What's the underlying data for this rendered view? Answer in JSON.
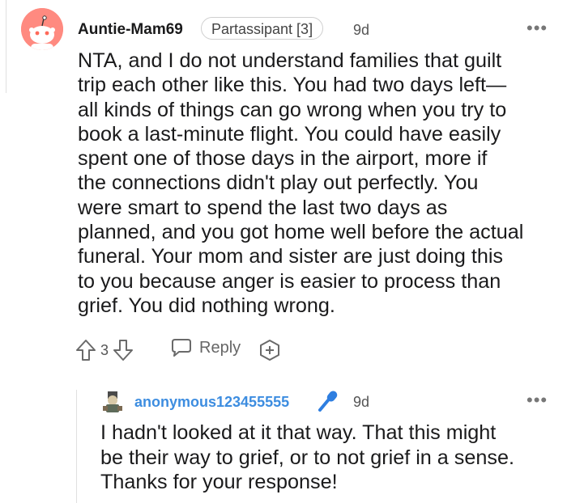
{
  "comment": {
    "author": "Auntie-Mam69",
    "flair": "Partassipant [3]",
    "age": "9d",
    "more": "•••",
    "body": "NTA, and I do not understand families that guilt\ntrip each other like this. You had two days left—\nall kinds of things can go wrong when you try to\nbook a last-minute flight. You could have easily\nspent one of those days in the airport, more if\nthe connections didn't play out perfectly. You\nwere smart to spend the last two days as\nplanned, and you got home well before the actual\nfuneral. Your mom and sister are just doing this\nto you because anger is easier to process than\ngrief. You did nothing wrong.",
    "score": "3",
    "reply_label": "Reply",
    "icons": [
      "upvote-icon",
      "downvote-icon",
      "reply-bubble-icon",
      "award-plus-icon"
    ]
  },
  "reply": {
    "author": "anonymous123455555",
    "age": "9d",
    "more": "•••",
    "body": "I hadn't looked at it that way. That this might\nbe their way to grief, or to not grief in a sense.\nThanks for your response!",
    "icons": [
      "op-mic-icon"
    ]
  },
  "colors": {
    "username_blue": "#3d8de0",
    "avatar_bg": "#ff8a80",
    "mic_blue": "#2e7ee0"
  }
}
